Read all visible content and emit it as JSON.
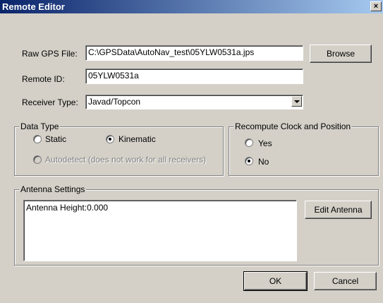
{
  "window": {
    "title": "Remote Editor",
    "close_glyph": "×"
  },
  "raw_gps": {
    "label": "Raw GPS File:",
    "value": "C:\\GPSData\\AutoNav_test\\05YLW0531a.jps",
    "browse_label": "Browse"
  },
  "remote_id": {
    "label": "Remote ID:",
    "value": "05YLW0531a"
  },
  "receiver_type": {
    "label": "Receiver Type:",
    "value": "Javad/Topcon"
  },
  "data_type": {
    "title": "Data Type",
    "static_label": "Static",
    "kinematic_label": "Kinematic",
    "autodetect_label": "Autodetect (does not work for all receivers)",
    "selected": "Kinematic"
  },
  "recompute": {
    "title": "Recompute Clock and Position",
    "yes_label": "Yes",
    "no_label": "No",
    "selected": "No"
  },
  "antenna": {
    "title": "Antenna Settings",
    "text": "Antenna Height:0.000",
    "edit_label": "Edit Antenna"
  },
  "buttons": {
    "ok_label": "OK",
    "cancel_label": "Cancel"
  }
}
